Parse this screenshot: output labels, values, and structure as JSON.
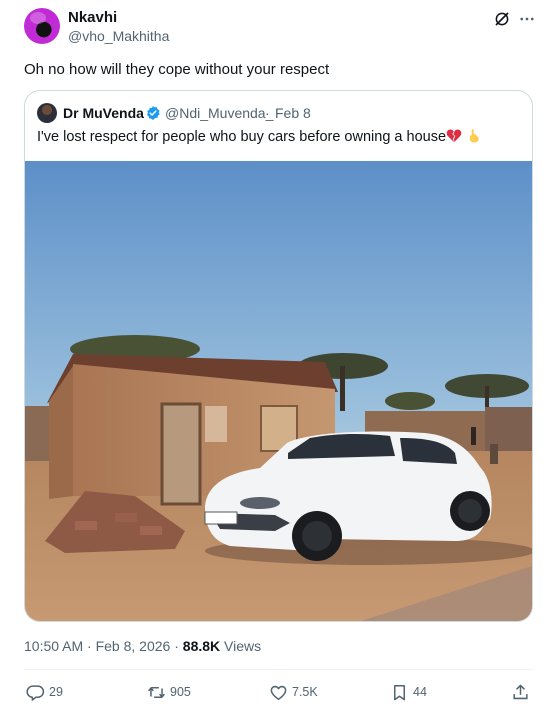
{
  "post": {
    "author_name": "Nkavhi",
    "author_handle": "@vho_Makhitha",
    "text": "Oh no how will they cope without your respect",
    "timestamp": "10:50 AM · Feb 8, 2026",
    "views_count": "88.8K",
    "views_label": "Views"
  },
  "quoted": {
    "author_name": "Dr MuVenda",
    "author_handle": "@Ndi_Muvenda_",
    "separator": "·",
    "date": "Feb 8",
    "text": "I've lost respect for people who buy cars before owning a house"
  },
  "actions": {
    "replies": "29",
    "reposts": "905",
    "likes": "7.5K",
    "bookmarks": "44"
  },
  "icons": [
    "grok-icon",
    "more-icon",
    "verified-icon",
    "broken-heart-emoji",
    "hand-emoji",
    "reply-icon",
    "repost-icon",
    "like-icon",
    "bookmark-icon",
    "share-icon"
  ],
  "colors": {
    "accent": "#1d9bf0",
    "secondary_text": "#536471",
    "border": "#cfd9de"
  }
}
